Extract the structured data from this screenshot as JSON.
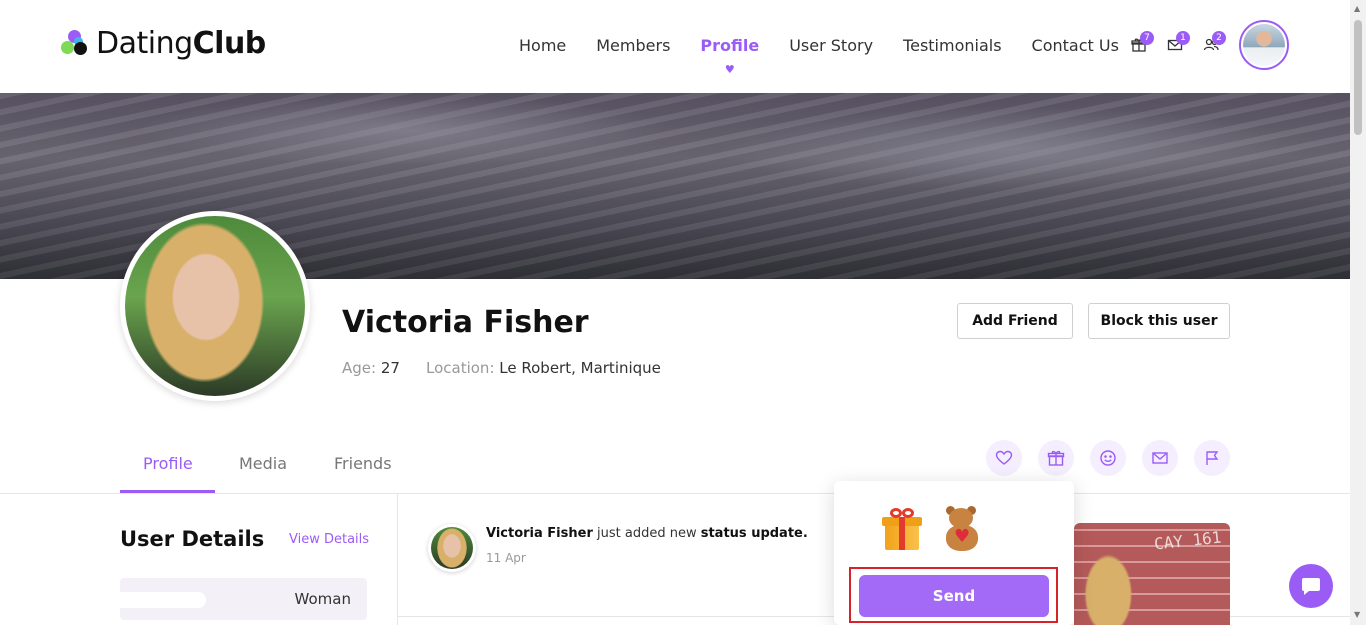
{
  "brand": {
    "name_light": "Dating",
    "name_bold": "Club"
  },
  "nav": {
    "items": [
      {
        "label": "Home"
      },
      {
        "label": "Members"
      },
      {
        "label": "Profile"
      },
      {
        "label": "User Story"
      },
      {
        "label": "Testimonials"
      },
      {
        "label": "Contact Us"
      }
    ],
    "active": "Profile"
  },
  "header_icons": {
    "gifts": {
      "icon": "gift-icon",
      "badge": "7"
    },
    "messages": {
      "icon": "mail-icon",
      "badge": "1"
    },
    "friends": {
      "icon": "users-icon",
      "badge": "2"
    }
  },
  "profile": {
    "name": "Victoria Fisher",
    "age_label": "Age:",
    "age_value": "27",
    "location_label": "Location:",
    "location_value": "Le Robert, Martinique",
    "add_friend_label": "Add Friend",
    "block_label": "Block this user"
  },
  "tabs": [
    {
      "label": "Profile"
    },
    {
      "label": "Media"
    },
    {
      "label": "Friends"
    }
  ],
  "action_icons": [
    "heart-icon",
    "gift-icon",
    "smile-icon",
    "mail-icon",
    "flag-icon"
  ],
  "user_details": {
    "title": "User Details",
    "link": "View Details",
    "rows": [
      {
        "value": "Woman"
      }
    ]
  },
  "activity": {
    "user": "Victoria Fisher",
    "text_middle": "just added new",
    "text_bold": "status update.",
    "date": "11 Apr"
  },
  "gift_popup": {
    "gifts": [
      "gift-box",
      "teddy-bear"
    ],
    "send_label": "Send"
  },
  "photo_card": {
    "graffiti_text": "CAY 161"
  },
  "colors": {
    "accent": "#9b5cf6",
    "send_button": "#a36af7",
    "highlight_border": "#d8222a",
    "accent_light_bg": "#f4eefe"
  }
}
